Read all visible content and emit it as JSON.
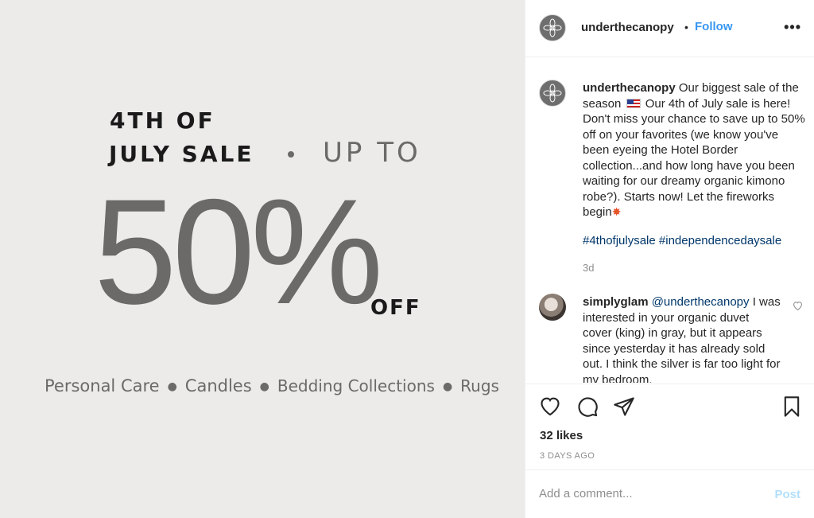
{
  "image": {
    "line1": "4TH OF",
    "line2": "JULY SALE",
    "upto": "UP TO",
    "percent": "50%",
    "off": "OFF",
    "categories": [
      "Personal Care",
      "Candles",
      "Bedding Collections",
      "Rugs"
    ],
    "background_color": "#ecebe9",
    "gray_color": "#6b6a68"
  },
  "header": {
    "username": "underthecanopy",
    "separator": "•",
    "follow_label": "Follow",
    "more_label": "•••"
  },
  "caption": {
    "username": "underthecanopy",
    "text_a": "Our biggest sale of the season",
    "text_b": "Our 4th of July sale is here! Don't miss your chance to save up to 50% off on your favorites (we know you've been eyeing the Hotel Border collection...and how long have you been waiting for our dreamy organic kimono robe?). Starts now! Let the fireworks begin",
    "burst_icon": "✸",
    "hashtags": "#4thofjulysale #independencedaysale",
    "time": "3d"
  },
  "comment": {
    "username": "simplyglam",
    "mention": "@underthecanopy",
    "text": "I was interested in your organic duvet cover (king) in gray, but it appears since yesterday it has already sold out. I think the silver is far too light for my bedroom."
  },
  "actions": {
    "likes": "32 likes",
    "time_ago": "3 DAYS AGO"
  },
  "add_comment": {
    "placeholder": "Add a comment...",
    "post_label": "Post"
  },
  "colors": {
    "accent_blue": "#3897f0",
    "post_disabled": "#b2dffc",
    "hashtag": "#00376b"
  }
}
